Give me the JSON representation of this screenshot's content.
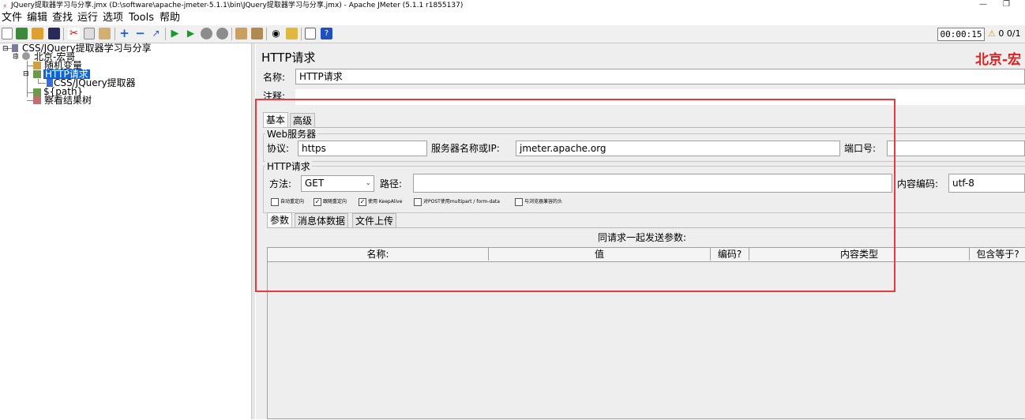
{
  "window": {
    "title": "JQuery提取器学习与分享.jmx (D:\\software\\apache-jmeter-5.1.1\\bin\\JQuery提取器学习与分享.jmx) - Apache JMeter (5.1.1 r1855137)",
    "minimize": "—",
    "restore": "❐"
  },
  "menu": [
    "文件",
    "编辑",
    "查找",
    "运行",
    "选项",
    "Tools",
    "帮助"
  ],
  "toolbar": {
    "icons": [
      "new-icon",
      "templates-icon",
      "open-icon",
      "save-icon",
      "cut-icon",
      "copy-icon",
      "paste-icon",
      "expand-icon",
      "collapse-icon",
      "toggle-icon",
      "start-icon",
      "start-no-pause-icon",
      "stop-icon",
      "shutdown-icon",
      "clear-icon",
      "clear-all-icon",
      "search-icon",
      "reset-search-icon",
      "function-helper-icon",
      "help-icon"
    ],
    "timer": "00:00:15",
    "warning_count": "0",
    "threads": "0/1"
  },
  "tree": {
    "root": "CSS/JQuery提取器学习与分享",
    "thread_group": "北京-宏哥",
    "random_var": "随机变量",
    "http_request": "HTTP请求",
    "extractor": "CSS/JQuery提取器",
    "path_sampler": "${path}",
    "listener": "察看结果树"
  },
  "panel": {
    "title": "HTTP请求",
    "brand": "北京-宏",
    "name_label": "名称:",
    "name_value": "HTTP请求",
    "comment_label": "注释:",
    "tabs": [
      "基本",
      "高级"
    ],
    "web_server": {
      "title": "Web服务器",
      "protocol_label": "协议:",
      "protocol_value": "https",
      "server_label": "服务器名称或IP:",
      "server_value": "jmeter.apache.org",
      "port_label": "端口号:",
      "port_value": ""
    },
    "http_request": {
      "title": "HTTP请求",
      "method_label": "方法:",
      "method_value": "GET",
      "path_label": "路径:",
      "path_value": "",
      "encoding_label": "内容编码:",
      "encoding_value": "utf-8"
    },
    "checkboxes": [
      {
        "label": "自动重定向",
        "checked": false
      },
      {
        "label": "跟随重定向",
        "checked": true
      },
      {
        "label": "使用 KeepAlive",
        "checked": true
      },
      {
        "label": "对POST使用multipart / form-data",
        "checked": false
      },
      {
        "label": "与浏览器兼容的头",
        "checked": false
      }
    ],
    "subtabs": [
      "参数",
      "消息体数据",
      "文件上传"
    ],
    "params_caption": "同请求一起发送参数:",
    "columns": [
      "名称:",
      "值",
      "编码?",
      "内容类型",
      "包含等于?"
    ]
  },
  "colors": {
    "annotation_red": "#e8393c",
    "selected_node": "#0a66d8",
    "brand_red": "#e02020"
  }
}
